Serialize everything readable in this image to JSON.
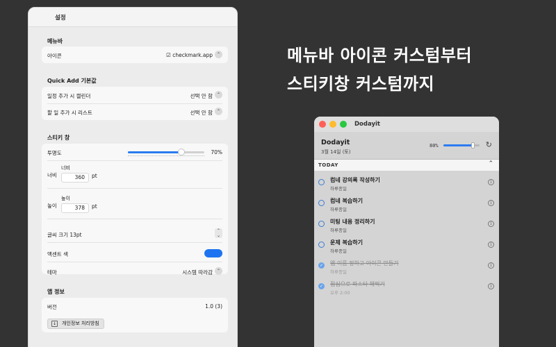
{
  "settings": {
    "title": "설정",
    "menubar": {
      "heading": "메뉴바",
      "icon_label": "아이콘",
      "icon_value": "checkmark.app",
      "icon_glyph": "☑"
    },
    "quick_add": {
      "heading": "Quick Add 기본값",
      "calendar_label": "일정 추가 시 캘린더",
      "calendar_value": "선택 안 함",
      "list_label": "할 일 추가 시 리스트",
      "list_value": "선택 안 함"
    },
    "sticky": {
      "heading": "스티키 창",
      "opacity_label": "투명도",
      "opacity_value": "70%",
      "opacity_fraction": 0.7,
      "width_label": "너비",
      "width_field_label": "너비",
      "width_value": "360",
      "width_unit": "pt",
      "height_label": "높이",
      "height_field_label": "높이",
      "height_value": "378",
      "height_unit": "pt",
      "font_size_label": "글씨 크기 13pt",
      "accent_label": "액센트 색",
      "accent_color": "#1e74f0",
      "theme_label": "테마",
      "theme_value": "시스템 따라감"
    },
    "app_info": {
      "heading": "앱 정보",
      "version_label": "버전",
      "version_value": "1.0 (3)",
      "privacy_button": "개인정보 처리방침"
    }
  },
  "hero": {
    "line1": "메뉴바 아이콘 커스텀부터",
    "line2": "스티키창 커스텀까지"
  },
  "dodayit": {
    "window_title": "Dodayit",
    "app_name": "Dodayit",
    "date": "3월 14일 (토)",
    "volume_label": "80%",
    "volume_fraction": 0.8,
    "section_label": "TODAY",
    "tasks": [
      {
        "name": "컴네 강의록 작성하기",
        "sub": "하루종일",
        "done": false
      },
      {
        "name": "컴네 복습하기",
        "sub": "하루종일",
        "done": false
      },
      {
        "name": "미팅 내용 정리하기",
        "sub": "하루종일",
        "done": false
      },
      {
        "name": "운제 복습하기",
        "sub": "하루종일",
        "done": false
      },
      {
        "name": "앱 이름 정하고 아이콘 만들기",
        "sub": "하루종일",
        "done": true
      },
      {
        "name": "점심으로 파스타 해먹기",
        "sub": "오후 2:00",
        "done": true
      }
    ]
  },
  "colors": {
    "accent": "#1e74f0",
    "close": "#ff5f57",
    "minimize": "#febc2e",
    "zoom": "#28c840"
  }
}
